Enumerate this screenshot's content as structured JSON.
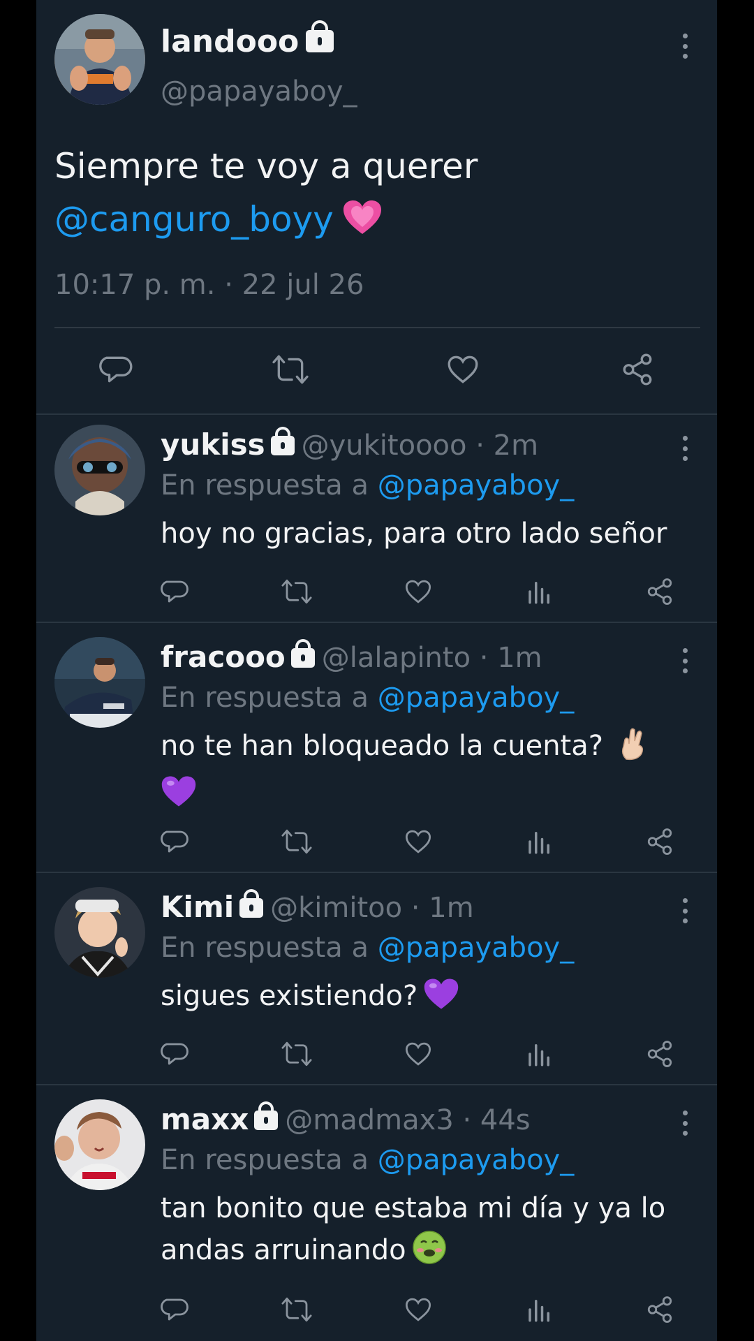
{
  "main_tweet": {
    "name": "landooo",
    "handle": "@papayaboy_",
    "text_before": "Siempre te voy a querer",
    "mention": "@canguro_boyy",
    "emoji": "pink-heart",
    "timestamp": "10:17 p. m. · 22 jul 26"
  },
  "replies": [
    {
      "name": "yukiss",
      "meta": "@yukitoooo · 2m",
      "replying_prefix": "En respuesta a",
      "replying_to": "@papayaboy_",
      "text": "hoy no gracias, para otro lado señor"
    },
    {
      "name": "fracooo",
      "meta": "@lalapinto · 1m",
      "replying_prefix": "En respuesta a",
      "replying_to": "@papayaboy_",
      "text": "no te han bloqueado la cuenta?"
    },
    {
      "name": "Kimi",
      "meta": "@kimitoo · 1m",
      "replying_prefix": "En respuesta a",
      "replying_to": "@papayaboy_",
      "text": "sigues existiendo?"
    },
    {
      "name": "maxx",
      "meta": "@madmax3 · 44s",
      "replying_prefix": "En respuesta a",
      "replying_to": "@papayaboy_",
      "text": "tan bonito que estaba mi día y ya lo andas arruinando"
    }
  ],
  "colors": {
    "background": "#15202b",
    "link": "#1d9bf0",
    "muted": "#6e7781",
    "text": "#f2f3f4"
  }
}
